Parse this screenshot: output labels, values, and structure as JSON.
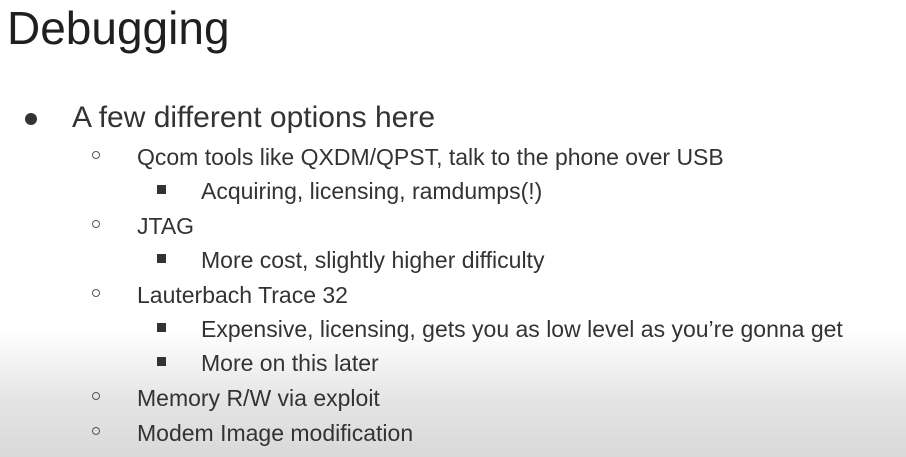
{
  "slide": {
    "title": "Debugging",
    "items": [
      {
        "level": 1,
        "marker": "filled-circle-bullet",
        "text": "A few different options here"
      },
      {
        "level": 2,
        "marker": "hollow-circle-bullet",
        "text": "Qcom tools like QXDM/QPST, talk to the phone over USB"
      },
      {
        "level": 3,
        "marker": "square-bullet",
        "text": "Acquiring, licensing, ramdumps(!)"
      },
      {
        "level": 2,
        "marker": "hollow-circle-bullet",
        "text": "JTAG"
      },
      {
        "level": 3,
        "marker": "square-bullet",
        "text": "More cost, slightly higher difficulty"
      },
      {
        "level": 2,
        "marker": "hollow-circle-bullet",
        "text": "Lauterbach Trace 32"
      },
      {
        "level": 3,
        "marker": "square-bullet",
        "text": "Expensive, licensing, gets you as low level as you’re gonna get"
      },
      {
        "level": 3,
        "marker": "square-bullet",
        "text": "More on this later"
      },
      {
        "level": 2,
        "marker": "hollow-circle-bullet",
        "text": "Memory R/W via exploit"
      },
      {
        "level": 2,
        "marker": "hollow-circle-bullet",
        "text": "Modem Image modification"
      }
    ]
  }
}
